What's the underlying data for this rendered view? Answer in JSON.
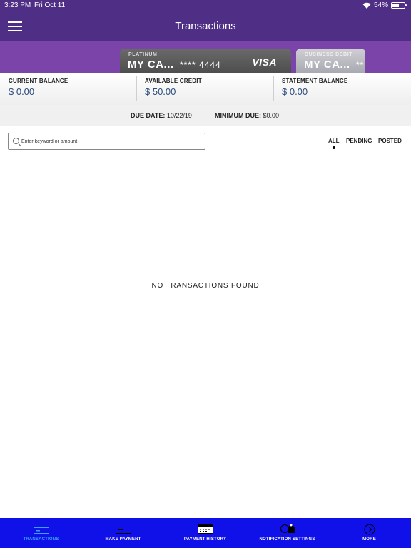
{
  "status_bar": {
    "time": "3:23 PM",
    "date": "Fri Oct 11",
    "battery": "54%",
    "battery_level": 0.54
  },
  "header": {
    "title": "Transactions",
    "menu_icon": "hamburger-icon"
  },
  "cards": [
    {
      "type": "PLATINUM",
      "name": "MY CA...",
      "number": "**** 4444",
      "network": "VISA"
    },
    {
      "type": "BUSINESS DEBIT",
      "name": "MY CA...",
      "number": "**"
    }
  ],
  "balances": {
    "current": {
      "label": "CURRENT BALANCE",
      "value": "$ 0.00"
    },
    "available": {
      "label": "AVAILABLE CREDIT",
      "value": "$ 50.00"
    },
    "statement": {
      "label": "STATEMENT BALANCE",
      "value": "$ 0.00"
    }
  },
  "due": {
    "date_label": "DUE DATE:",
    "date_value": "10/22/19",
    "min_label": "MINIMUM DUE:",
    "min_value": "$0.00"
  },
  "search": {
    "placeholder": "Enter keyword or amount",
    "icon": "search-icon"
  },
  "filters": [
    {
      "label": "ALL",
      "selected": true
    },
    {
      "label": "PENDING",
      "selected": false
    },
    {
      "label": "POSTED",
      "selected": false
    }
  ],
  "empty_message": "NO TRANSACTIONS FOUND",
  "tabs": [
    {
      "label": "TRANSACTIONS",
      "icon": "card-icon",
      "active": true
    },
    {
      "label": "MAKE PAYMENT",
      "icon": "payment-icon",
      "active": false
    },
    {
      "label": "PAYMENT HISTORY",
      "icon": "calendar-icon",
      "active": false
    },
    {
      "label": "NOTIFICATION SETTINGS",
      "icon": "bell-icon",
      "active": false
    },
    {
      "label": "MORE",
      "icon": "more-icon",
      "active": false
    }
  ],
  "colors": {
    "header": "#4f2f86",
    "carousel": "#7b44a8",
    "tabbar": "#1010e8",
    "active_tab": "#3aa0ff",
    "balance_value": "#2a4b7c"
  }
}
